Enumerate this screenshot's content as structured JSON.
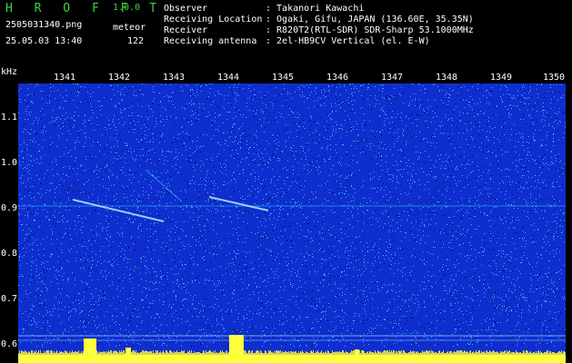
{
  "app": {
    "title": "H R O F F T",
    "version": "1.0.0"
  },
  "file": {
    "name": "2505031340.png",
    "mode": "meteor",
    "datetime": "25.05.03 13:40",
    "count": "122"
  },
  "info": [
    {
      "label": "Observer",
      "value": ": Takanori Kawachi"
    },
    {
      "label": "Receiving Location",
      "value": ": Ogaki, Gifu, JAPAN (136.60E, 35.35N)"
    },
    {
      "label": "Receiver",
      "value": ": R820T2(RTL-SDR) SDR-Sharp 53.1000MHz"
    },
    {
      "label": "Receiving antenna",
      "value": ": 2el-HB9CV Vertical (el. E-W)"
    }
  ],
  "axis": {
    "unit": "kHz",
    "time_labels": [
      "1341",
      "1342",
      "1343",
      "1344",
      "1345",
      "1346",
      "1347",
      "1348",
      "1349",
      "1350"
    ],
    "freq_labels": [
      "1.1",
      "1.0",
      "0.9",
      "0.8",
      "0.7",
      "0.6"
    ]
  },
  "colors": {
    "background": "#0f2ecf",
    "noise": "#39d1ff",
    "signal": "#ffff3c",
    "title": "#3cd63c"
  }
}
